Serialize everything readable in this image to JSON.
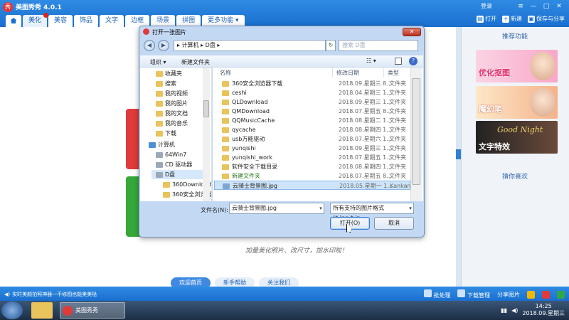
{
  "app": {
    "title": "美图秀秀 4.0.1",
    "login": "登录",
    "window_controls": [
      "≡",
      "—",
      "□",
      "✕"
    ]
  },
  "tabs": [
    "美化",
    "美容",
    "饰品",
    "文字",
    "边框",
    "场景",
    "拼图",
    "更多功能 ▾"
  ],
  "top_actions": {
    "open": "打开",
    "new": "新建",
    "save_share": "保存与分享"
  },
  "canvas": {
    "slogan": "加量美化照片、改尺寸，加水印啦！"
  },
  "bottom_tabs": [
    "欢迎首页",
    "新手帮助",
    "关注我们"
  ],
  "right_panel": {
    "recommended_title": "推荐功能",
    "promos": [
      {
        "label": "优化抠图"
      },
      {
        "label": "魔幻笔"
      },
      {
        "script": "Good Night",
        "label": "文字特效"
      }
    ],
    "guess_title": "猜你喜欢"
  },
  "status_bar": {
    "message": "实时美颜拍照神器一不修图也能美美哒",
    "batch": "批处理",
    "downloads": "下载管理",
    "share": "分享图片"
  },
  "taskbar": {
    "app_label": "美图秀秀",
    "time": "14:25",
    "date": "2018.09.星期三"
  },
  "dialog": {
    "title": "打开一张图片",
    "address": "▸ 计算机 ▸ D盘 ▸",
    "search_placeholder": "搜索 D盘",
    "organize": "组织 ▾",
    "new_folder": "新建文件夹",
    "columns": {
      "name": "名称",
      "date": "修改日期",
      "type": "类型"
    },
    "nav_items": [
      {
        "label": "收藏夹",
        "icon": "folder"
      },
      {
        "label": "搜索",
        "icon": "folder"
      },
      {
        "label": "我的视频",
        "icon": "folder"
      },
      {
        "label": "我的图片",
        "icon": "folder"
      },
      {
        "label": "我的文档",
        "icon": "folder"
      },
      {
        "label": "我的音乐",
        "icon": "folder"
      },
      {
        "label": "下载",
        "icon": "folder"
      },
      {
        "label": "计算机",
        "icon": "computer"
      },
      {
        "label": "64Win7",
        "icon": "drive"
      },
      {
        "label": "CD 驱动器",
        "icon": "drive"
      },
      {
        "label": "D盘",
        "icon": "drive"
      },
      {
        "label": "360Downloads",
        "icon": "folder"
      },
      {
        "label": "360安全浏览器",
        "icon": "folder"
      }
    ],
    "files": [
      {
        "name": "360安全浏览器下载",
        "date": "2018.09.星期三 8...",
        "type": "文件夹"
      },
      {
        "name": "ceshi",
        "date": "2018.04.星期三 1...",
        "type": "文件夹"
      },
      {
        "name": "QLDownload",
        "date": "2018.09.星期三 1...",
        "type": "文件夹"
      },
      {
        "name": "QMDownload",
        "date": "2018.07.星期五 8...",
        "type": "文件夹"
      },
      {
        "name": "QQMusicCache",
        "date": "2018.08.星期二 1...",
        "type": "文件夹"
      },
      {
        "name": "qycache",
        "date": "2018.08.星期四 1...",
        "type": "文件夹"
      },
      {
        "name": "usb万能驱动",
        "date": "2018.07.星期六 1...",
        "type": "文件夹"
      },
      {
        "name": "yunqishi",
        "date": "2018.09.星期三 1...",
        "type": "文件夹"
      },
      {
        "name": "yunqishi_work",
        "date": "2018.07.星期五 1...",
        "type": "文件夹"
      },
      {
        "name": "软件安全下载目录",
        "date": "2018.08.星期四 1...",
        "type": "文件夹"
      },
      {
        "name": "新建文件夹",
        "date": "2018.07.星期五 8...",
        "type": "文件夹"
      },
      {
        "name": "云骑士背景图.jpg",
        "date": "2018.05.星期一 1...",
        "type": "Kankan"
      }
    ],
    "filename_label": "文件名(N):",
    "filename_value": "云骑士背景图.jpg",
    "filetype_value": "所有支持的图片格式 (*.jpg;*.jp",
    "open_button": "打开(O)",
    "cancel_button": "取消"
  }
}
